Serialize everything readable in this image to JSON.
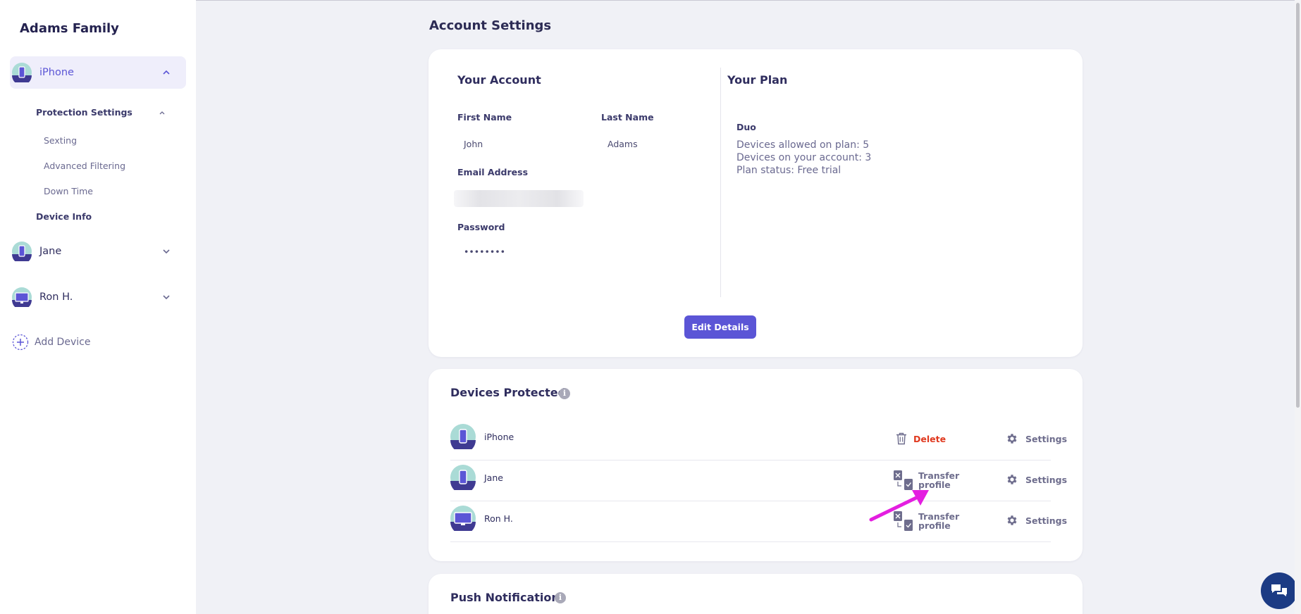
{
  "sidebar": {
    "family_title": "Adams Family",
    "devices": [
      {
        "label": "iPhone",
        "icon": "phone-avatar-icon",
        "expanded": true
      },
      {
        "label": "Jane",
        "icon": "phone-avatar-icon",
        "expanded": false
      },
      {
        "label": "Ron H.",
        "icon": "desktop-avatar-icon",
        "expanded": false
      }
    ],
    "protection_settings": "Protection Settings",
    "sub_items": [
      "Sexting",
      "Advanced Filtering",
      "Down Time"
    ],
    "device_info": "Device Info",
    "add_device": "Add Device"
  },
  "page_title": "Account Settings",
  "account": {
    "heading": "Your Account",
    "first_name_label": "First Name",
    "first_name": "John",
    "last_name_label": "Last Name",
    "last_name": "Adams",
    "email_label": "Email Address",
    "password_label": "Password",
    "password": "••••••••",
    "edit_button": "Edit Details"
  },
  "plan": {
    "heading": "Your Plan",
    "name": "Duo",
    "lines": [
      "Devices allowed on plan: 5",
      "Devices on your account: 3",
      "Plan status: Free trial"
    ]
  },
  "devices_protected": {
    "heading": "Devices Protected",
    "items": [
      {
        "name": "iPhone",
        "action": "Delete",
        "settings": "Settings"
      },
      {
        "name": "Jane",
        "action_line1": "Transfer",
        "action_line2": "profile",
        "settings": "Settings"
      },
      {
        "name": "Ron H.",
        "action_line1": "Transfer",
        "action_line2": "profile",
        "settings": "Settings"
      }
    ]
  },
  "push_notifications": {
    "heading": "Push Notifications"
  },
  "colors": {
    "accent": "#5b55d6",
    "danger": "#e0391f",
    "annotation_arrow": "#e41ee0",
    "chat": "#1c3b84"
  }
}
